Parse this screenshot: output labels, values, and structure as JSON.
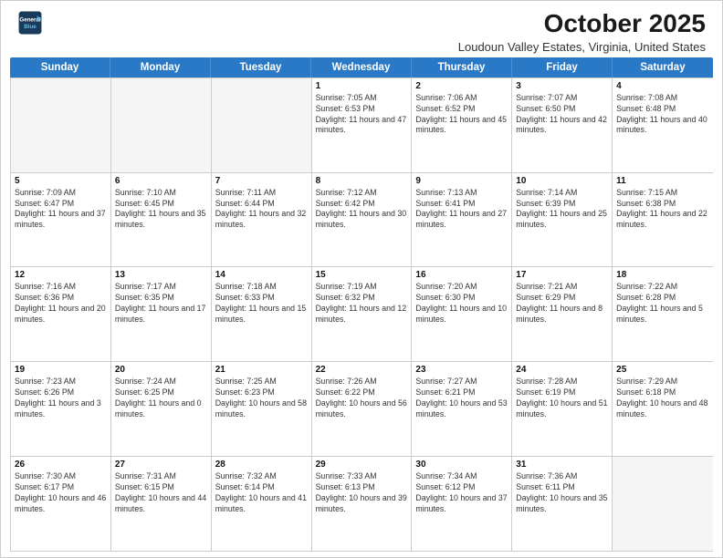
{
  "header": {
    "logo_line1": "General",
    "logo_line2": "Blue",
    "month": "October 2025",
    "location": "Loudoun Valley Estates, Virginia, United States"
  },
  "days_of_week": [
    "Sunday",
    "Monday",
    "Tuesday",
    "Wednesday",
    "Thursday",
    "Friday",
    "Saturday"
  ],
  "weeks": [
    [
      {
        "day": "",
        "empty": true
      },
      {
        "day": "",
        "empty": true
      },
      {
        "day": "",
        "empty": true
      },
      {
        "day": "1",
        "sunrise": "7:05 AM",
        "sunset": "6:53 PM",
        "daylight": "11 hours and 47 minutes."
      },
      {
        "day": "2",
        "sunrise": "7:06 AM",
        "sunset": "6:52 PM",
        "daylight": "11 hours and 45 minutes."
      },
      {
        "day": "3",
        "sunrise": "7:07 AM",
        "sunset": "6:50 PM",
        "daylight": "11 hours and 42 minutes."
      },
      {
        "day": "4",
        "sunrise": "7:08 AM",
        "sunset": "6:48 PM",
        "daylight": "11 hours and 40 minutes."
      }
    ],
    [
      {
        "day": "5",
        "sunrise": "7:09 AM",
        "sunset": "6:47 PM",
        "daylight": "11 hours and 37 minutes."
      },
      {
        "day": "6",
        "sunrise": "7:10 AM",
        "sunset": "6:45 PM",
        "daylight": "11 hours and 35 minutes."
      },
      {
        "day": "7",
        "sunrise": "7:11 AM",
        "sunset": "6:44 PM",
        "daylight": "11 hours and 32 minutes."
      },
      {
        "day": "8",
        "sunrise": "7:12 AM",
        "sunset": "6:42 PM",
        "daylight": "11 hours and 30 minutes."
      },
      {
        "day": "9",
        "sunrise": "7:13 AM",
        "sunset": "6:41 PM",
        "daylight": "11 hours and 27 minutes."
      },
      {
        "day": "10",
        "sunrise": "7:14 AM",
        "sunset": "6:39 PM",
        "daylight": "11 hours and 25 minutes."
      },
      {
        "day": "11",
        "sunrise": "7:15 AM",
        "sunset": "6:38 PM",
        "daylight": "11 hours and 22 minutes."
      }
    ],
    [
      {
        "day": "12",
        "sunrise": "7:16 AM",
        "sunset": "6:36 PM",
        "daylight": "11 hours and 20 minutes."
      },
      {
        "day": "13",
        "sunrise": "7:17 AM",
        "sunset": "6:35 PM",
        "daylight": "11 hours and 17 minutes."
      },
      {
        "day": "14",
        "sunrise": "7:18 AM",
        "sunset": "6:33 PM",
        "daylight": "11 hours and 15 minutes."
      },
      {
        "day": "15",
        "sunrise": "7:19 AM",
        "sunset": "6:32 PM",
        "daylight": "11 hours and 12 minutes."
      },
      {
        "day": "16",
        "sunrise": "7:20 AM",
        "sunset": "6:30 PM",
        "daylight": "11 hours and 10 minutes."
      },
      {
        "day": "17",
        "sunrise": "7:21 AM",
        "sunset": "6:29 PM",
        "daylight": "11 hours and 8 minutes."
      },
      {
        "day": "18",
        "sunrise": "7:22 AM",
        "sunset": "6:28 PM",
        "daylight": "11 hours and 5 minutes."
      }
    ],
    [
      {
        "day": "19",
        "sunrise": "7:23 AM",
        "sunset": "6:26 PM",
        "daylight": "11 hours and 3 minutes."
      },
      {
        "day": "20",
        "sunrise": "7:24 AM",
        "sunset": "6:25 PM",
        "daylight": "11 hours and 0 minutes."
      },
      {
        "day": "21",
        "sunrise": "7:25 AM",
        "sunset": "6:23 PM",
        "daylight": "10 hours and 58 minutes."
      },
      {
        "day": "22",
        "sunrise": "7:26 AM",
        "sunset": "6:22 PM",
        "daylight": "10 hours and 56 minutes."
      },
      {
        "day": "23",
        "sunrise": "7:27 AM",
        "sunset": "6:21 PM",
        "daylight": "10 hours and 53 minutes."
      },
      {
        "day": "24",
        "sunrise": "7:28 AM",
        "sunset": "6:19 PM",
        "daylight": "10 hours and 51 minutes."
      },
      {
        "day": "25",
        "sunrise": "7:29 AM",
        "sunset": "6:18 PM",
        "daylight": "10 hours and 48 minutes."
      }
    ],
    [
      {
        "day": "26",
        "sunrise": "7:30 AM",
        "sunset": "6:17 PM",
        "daylight": "10 hours and 46 minutes."
      },
      {
        "day": "27",
        "sunrise": "7:31 AM",
        "sunset": "6:15 PM",
        "daylight": "10 hours and 44 minutes."
      },
      {
        "day": "28",
        "sunrise": "7:32 AM",
        "sunset": "6:14 PM",
        "daylight": "10 hours and 41 minutes."
      },
      {
        "day": "29",
        "sunrise": "7:33 AM",
        "sunset": "6:13 PM",
        "daylight": "10 hours and 39 minutes."
      },
      {
        "day": "30",
        "sunrise": "7:34 AM",
        "sunset": "6:12 PM",
        "daylight": "10 hours and 37 minutes."
      },
      {
        "day": "31",
        "sunrise": "7:36 AM",
        "sunset": "6:11 PM",
        "daylight": "10 hours and 35 minutes."
      },
      {
        "day": "",
        "empty": true
      }
    ]
  ]
}
